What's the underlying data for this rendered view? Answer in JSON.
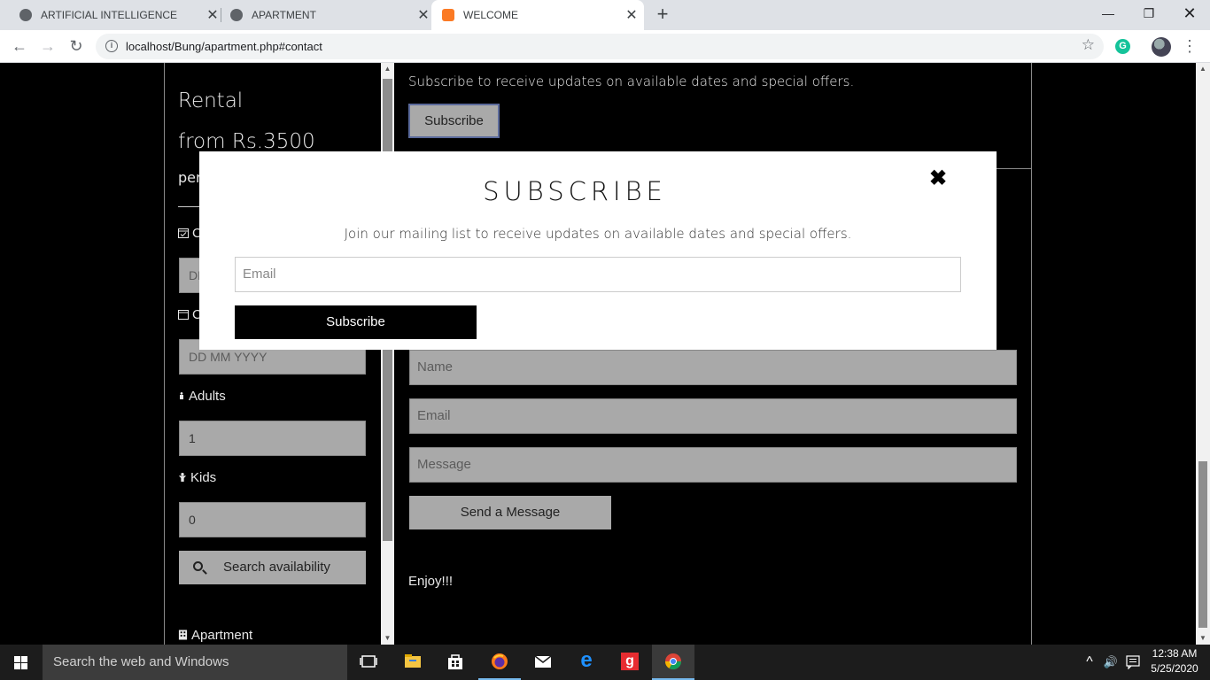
{
  "browser": {
    "tabs": [
      {
        "title": "ARTIFICIAL INTELLIGENCE",
        "close": "✕"
      },
      {
        "title": "APARTMENT",
        "close": "✕"
      },
      {
        "title": "WELCOME",
        "close": "✕"
      }
    ],
    "new_tab": "+",
    "window_controls": {
      "minimize": "—",
      "maximize": "❐",
      "close": "✕"
    },
    "nav": {
      "back": "←",
      "forward": "→",
      "reload": "↻"
    },
    "url": "localhost/Bung/apartment.php#contact",
    "info_icon": "i",
    "bookmark_star": "☆",
    "grammarly": "G",
    "menu": "⋮"
  },
  "sidebar": {
    "rental_title": "Rental",
    "rental_price": "from Rs.3500",
    "rental_per": "per",
    "checkin_label": "C",
    "checkin_placeholder": "DD",
    "checkout_label": "C",
    "checkout_placeholder": "DD MM YYYY",
    "adults_label": "Adults",
    "adults_value": "1",
    "kids_label": "Kids",
    "kids_value": "0",
    "search_label": "Search availability",
    "apartment_label": "Apartment"
  },
  "main": {
    "subscribe_text": "Subscribe to receive updates on available dates and special offers.",
    "subscribe_button": "Subscribe",
    "contact": {
      "name_placeholder": "Name",
      "email_placeholder": "Email",
      "message_placeholder": "Message",
      "send_button": "Send a Message"
    },
    "enjoy_text": "Enjoy!!!"
  },
  "modal": {
    "title": "SUBSCRIBE",
    "close": "✖",
    "description": "Join our mailing list to receive updates on available dates and special offers.",
    "email_placeholder": "Email",
    "button": "Subscribe"
  },
  "taskbar": {
    "search_placeholder": "Search the web and Windows",
    "edge_letter": "e",
    "gaana_letter": "g",
    "tray_up": "^",
    "tray_volume": "🔊",
    "time": "12:38 AM",
    "date": "5/25/2020"
  }
}
